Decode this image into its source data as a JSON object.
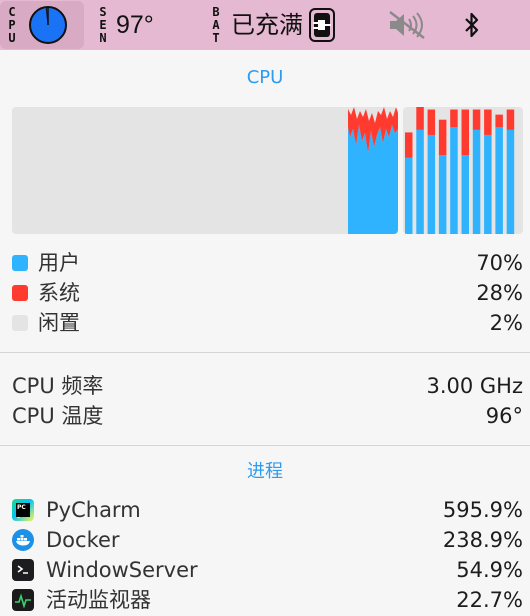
{
  "menubar": {
    "cpu_label": [
      "C",
      "P",
      "U"
    ],
    "sen_label": [
      "S",
      "E",
      "N"
    ],
    "sen_value": "97°",
    "bat_label": [
      "B",
      "A",
      "T"
    ],
    "bat_status": "已充满",
    "icons": [
      "cpu-pie-icon",
      "power-plug-icon",
      "speaker-muted-icon",
      "bluetooth-icon"
    ],
    "cpu_pie_color": "#1a73f5"
  },
  "cpu": {
    "title": "CPU",
    "history": {
      "note_colors": {
        "user": "#2fb3ff",
        "system": "#ff3b30",
        "idle": "#e4e4e4"
      }
    },
    "cores": [
      {
        "user": 0.6,
        "system": 0.2
      },
      {
        "user": 0.82,
        "system": 0.18
      },
      {
        "user": 0.78,
        "system": 0.2
      },
      {
        "user": 0.62,
        "system": 0.28
      },
      {
        "user": 0.84,
        "system": 0.14
      },
      {
        "user": 0.62,
        "system": 0.36
      },
      {
        "user": 0.82,
        "system": 0.16
      },
      {
        "user": 0.78,
        "system": 0.2
      },
      {
        "user": 0.84,
        "system": 0.1
      },
      {
        "user": 0.82,
        "system": 0.16
      }
    ],
    "breakdown": [
      {
        "label": "用户",
        "value": "70%",
        "color": "#2fb3ff"
      },
      {
        "label": "系统",
        "value": "28%",
        "color": "#ff3b30"
      },
      {
        "label": "闲置",
        "value": "2%",
        "color": "#e4e4e4"
      }
    ],
    "frequency": {
      "label": "CPU 频率",
      "value": "3.00 GHz"
    },
    "temperature": {
      "label": "CPU 温度",
      "value": "96°"
    }
  },
  "processes": {
    "title": "进程",
    "items": [
      {
        "name": "PyCharm",
        "value": "595.9%",
        "icon": "pycharm-icon"
      },
      {
        "name": "Docker",
        "value": "238.9%",
        "icon": "docker-icon"
      },
      {
        "name": "WindowServer",
        "value": "54.9%",
        "icon": "terminal-icon"
      },
      {
        "name": "活动监视器",
        "value": "22.7%",
        "icon": "activity-monitor-icon"
      }
    ]
  }
}
